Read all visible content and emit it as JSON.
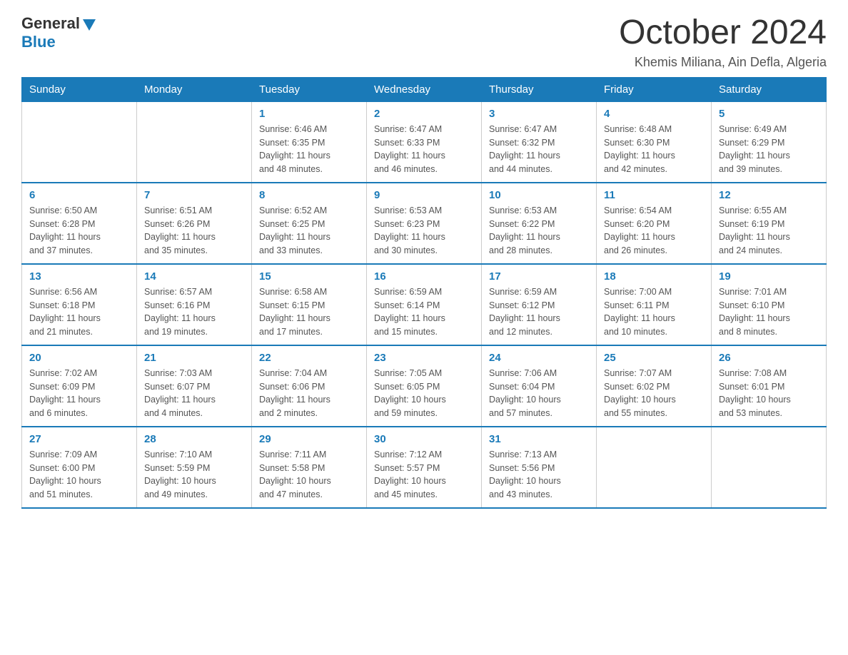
{
  "header": {
    "logo_general": "General",
    "logo_blue": "Blue",
    "month_title": "October 2024",
    "location": "Khemis Miliana, Ain Defla, Algeria"
  },
  "days_of_week": [
    "Sunday",
    "Monday",
    "Tuesday",
    "Wednesday",
    "Thursday",
    "Friday",
    "Saturday"
  ],
  "weeks": [
    [
      {
        "day": "",
        "info": ""
      },
      {
        "day": "",
        "info": ""
      },
      {
        "day": "1",
        "info": "Sunrise: 6:46 AM\nSunset: 6:35 PM\nDaylight: 11 hours\nand 48 minutes."
      },
      {
        "day": "2",
        "info": "Sunrise: 6:47 AM\nSunset: 6:33 PM\nDaylight: 11 hours\nand 46 minutes."
      },
      {
        "day": "3",
        "info": "Sunrise: 6:47 AM\nSunset: 6:32 PM\nDaylight: 11 hours\nand 44 minutes."
      },
      {
        "day": "4",
        "info": "Sunrise: 6:48 AM\nSunset: 6:30 PM\nDaylight: 11 hours\nand 42 minutes."
      },
      {
        "day": "5",
        "info": "Sunrise: 6:49 AM\nSunset: 6:29 PM\nDaylight: 11 hours\nand 39 minutes."
      }
    ],
    [
      {
        "day": "6",
        "info": "Sunrise: 6:50 AM\nSunset: 6:28 PM\nDaylight: 11 hours\nand 37 minutes."
      },
      {
        "day": "7",
        "info": "Sunrise: 6:51 AM\nSunset: 6:26 PM\nDaylight: 11 hours\nand 35 minutes."
      },
      {
        "day": "8",
        "info": "Sunrise: 6:52 AM\nSunset: 6:25 PM\nDaylight: 11 hours\nand 33 minutes."
      },
      {
        "day": "9",
        "info": "Sunrise: 6:53 AM\nSunset: 6:23 PM\nDaylight: 11 hours\nand 30 minutes."
      },
      {
        "day": "10",
        "info": "Sunrise: 6:53 AM\nSunset: 6:22 PM\nDaylight: 11 hours\nand 28 minutes."
      },
      {
        "day": "11",
        "info": "Sunrise: 6:54 AM\nSunset: 6:20 PM\nDaylight: 11 hours\nand 26 minutes."
      },
      {
        "day": "12",
        "info": "Sunrise: 6:55 AM\nSunset: 6:19 PM\nDaylight: 11 hours\nand 24 minutes."
      }
    ],
    [
      {
        "day": "13",
        "info": "Sunrise: 6:56 AM\nSunset: 6:18 PM\nDaylight: 11 hours\nand 21 minutes."
      },
      {
        "day": "14",
        "info": "Sunrise: 6:57 AM\nSunset: 6:16 PM\nDaylight: 11 hours\nand 19 minutes."
      },
      {
        "day": "15",
        "info": "Sunrise: 6:58 AM\nSunset: 6:15 PM\nDaylight: 11 hours\nand 17 minutes."
      },
      {
        "day": "16",
        "info": "Sunrise: 6:59 AM\nSunset: 6:14 PM\nDaylight: 11 hours\nand 15 minutes."
      },
      {
        "day": "17",
        "info": "Sunrise: 6:59 AM\nSunset: 6:12 PM\nDaylight: 11 hours\nand 12 minutes."
      },
      {
        "day": "18",
        "info": "Sunrise: 7:00 AM\nSunset: 6:11 PM\nDaylight: 11 hours\nand 10 minutes."
      },
      {
        "day": "19",
        "info": "Sunrise: 7:01 AM\nSunset: 6:10 PM\nDaylight: 11 hours\nand 8 minutes."
      }
    ],
    [
      {
        "day": "20",
        "info": "Sunrise: 7:02 AM\nSunset: 6:09 PM\nDaylight: 11 hours\nand 6 minutes."
      },
      {
        "day": "21",
        "info": "Sunrise: 7:03 AM\nSunset: 6:07 PM\nDaylight: 11 hours\nand 4 minutes."
      },
      {
        "day": "22",
        "info": "Sunrise: 7:04 AM\nSunset: 6:06 PM\nDaylight: 11 hours\nand 2 minutes."
      },
      {
        "day": "23",
        "info": "Sunrise: 7:05 AM\nSunset: 6:05 PM\nDaylight: 10 hours\nand 59 minutes."
      },
      {
        "day": "24",
        "info": "Sunrise: 7:06 AM\nSunset: 6:04 PM\nDaylight: 10 hours\nand 57 minutes."
      },
      {
        "day": "25",
        "info": "Sunrise: 7:07 AM\nSunset: 6:02 PM\nDaylight: 10 hours\nand 55 minutes."
      },
      {
        "day": "26",
        "info": "Sunrise: 7:08 AM\nSunset: 6:01 PM\nDaylight: 10 hours\nand 53 minutes."
      }
    ],
    [
      {
        "day": "27",
        "info": "Sunrise: 7:09 AM\nSunset: 6:00 PM\nDaylight: 10 hours\nand 51 minutes."
      },
      {
        "day": "28",
        "info": "Sunrise: 7:10 AM\nSunset: 5:59 PM\nDaylight: 10 hours\nand 49 minutes."
      },
      {
        "day": "29",
        "info": "Sunrise: 7:11 AM\nSunset: 5:58 PM\nDaylight: 10 hours\nand 47 minutes."
      },
      {
        "day": "30",
        "info": "Sunrise: 7:12 AM\nSunset: 5:57 PM\nDaylight: 10 hours\nand 45 minutes."
      },
      {
        "day": "31",
        "info": "Sunrise: 7:13 AM\nSunset: 5:56 PM\nDaylight: 10 hours\nand 43 minutes."
      },
      {
        "day": "",
        "info": ""
      },
      {
        "day": "",
        "info": ""
      }
    ]
  ]
}
